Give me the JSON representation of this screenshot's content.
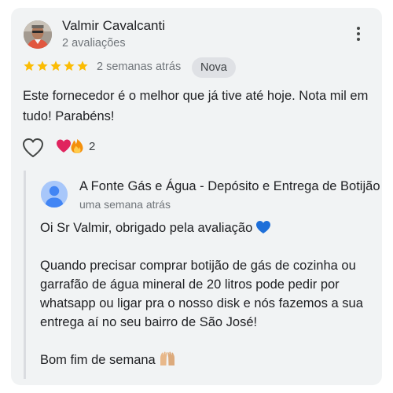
{
  "review": {
    "author": {
      "name": "Valmir Cavalcanti",
      "reviews_count": "2 avaliações",
      "avatar_icon": "user-photo-avatar"
    },
    "rating": 5,
    "rating_max": 5,
    "time": "2 semanas atrás",
    "badge": "Nova",
    "text": "Este fornecedor é o melhor que já tive até hoje. Nota mil em tudo! Parabéns!",
    "more_icon": "more-vertical-icon",
    "like_icon": "heart-outline-icon",
    "reaction_icons": [
      "heart-emoji",
      "fire-emoji"
    ],
    "reactions_count": "2"
  },
  "owner_reply": {
    "name": "A Fonte Gás e Água - Depósito e Entrega de Botijão",
    "time": "uma semana atrás",
    "avatar_icon": "default-person-avatar",
    "paragraphs": [
      "Oi Sr Valmir, obrigado pela avaliação",
      "Quando precisar comprar botijão de gás de cozinha ou garrafão de água mineral de 20 litros pode pedir por whatsapp ou ligar pra o nosso disk e nós fazemos a sua entrega aí no seu bairro de São José!",
      "Bom fim de semana"
    ],
    "paragraph_icons": [
      "blue-heart-emoji",
      "",
      "raising-hands-emoji"
    ]
  },
  "colors": {
    "card_bg": "#f1f3f4",
    "star": "#fbbc04",
    "secondary_text": "#70757a",
    "badge_bg": "#dfe1e5",
    "owner_avatar": "#a8c7fa"
  }
}
